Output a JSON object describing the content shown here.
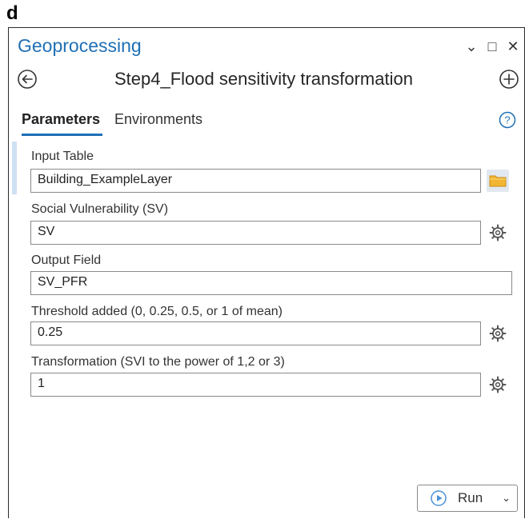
{
  "figure_label": "d",
  "pane": {
    "title": "Geoprocessing",
    "controls": {
      "options_glyph": "⌄",
      "maximize_glyph": "□",
      "close_glyph": "✕"
    }
  },
  "tool": {
    "title": "Step4_Flood sensitivity transformation"
  },
  "tabs": {
    "parameters": "Parameters",
    "environments": "Environments"
  },
  "params": [
    {
      "label": "Input Table",
      "value": "Building_ExampleLayer"
    },
    {
      "label": "Social Vulnerability (SV)",
      "value": "SV"
    },
    {
      "label": "Output Field",
      "value": "SV_PFR"
    },
    {
      "label": "Threshold added (0, 0.25, 0.5, or 1 of mean)",
      "value": "0.25"
    },
    {
      "label": "Transformation (SVI to the power of 1,2 or 3)",
      "value": "1"
    }
  ],
  "run": {
    "label": "Run",
    "caret": "⌄"
  },
  "colors": {
    "accent": "#1f6fb5",
    "folder": "#f2b632",
    "run_icon": "#4a90d9"
  }
}
